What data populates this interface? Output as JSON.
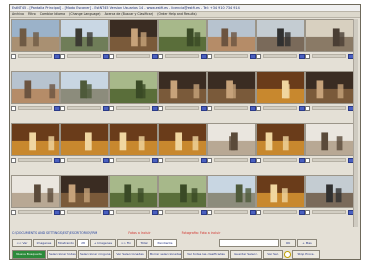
{
  "window": {
    "title": "EstNT45 - [Pantalla Principal] - [Modo Escaner] - EstNT45 Version Usuarios 14 - www.estfi.es - licencia@estfi.es - Tel: +34 910 734 914",
    "menu": [
      "Archivo",
      "Filtro",
      "Cambiar Idioma",
      "(Change Language)",
      "Acerca de (Buscar y Clasificar)",
      "(Order Help and Results)"
    ]
  },
  "thumbnails": [
    {
      "row": 0,
      "col": 0,
      "scene": "outdoor-street"
    },
    {
      "row": 0,
      "col": 1,
      "scene": "outdoor-people"
    },
    {
      "row": 0,
      "col": 2,
      "scene": "indoor-dark"
    },
    {
      "row": 0,
      "col": 3,
      "scene": "outdoor-garden"
    },
    {
      "row": 0,
      "col": 4,
      "scene": "outdoor-town"
    },
    {
      "row": 0,
      "col": 5,
      "scene": "outdoor-crowd"
    },
    {
      "row": 0,
      "col": 6,
      "scene": "outdoor-arch"
    },
    {
      "row": 1,
      "col": 0,
      "scene": "outdoor-town"
    },
    {
      "row": 1,
      "col": 1,
      "scene": "outdoor-road"
    },
    {
      "row": 1,
      "col": 2,
      "scene": "outdoor-garden"
    },
    {
      "row": 1,
      "col": 3,
      "scene": "indoor-dark"
    },
    {
      "row": 1,
      "col": 4,
      "scene": "indoor-dark"
    },
    {
      "row": 1,
      "col": 5,
      "scene": "indoor-warm"
    },
    {
      "row": 1,
      "col": 6,
      "scene": "indoor-dark"
    },
    {
      "row": 2,
      "col": 0,
      "scene": "indoor-warm"
    },
    {
      "row": 2,
      "col": 1,
      "scene": "indoor-warm"
    },
    {
      "row": 2,
      "col": 2,
      "scene": "indoor-warm"
    },
    {
      "row": 2,
      "col": 3,
      "scene": "indoor-warm"
    },
    {
      "row": 2,
      "col": 4,
      "scene": "indoor-light"
    },
    {
      "row": 2,
      "col": 5,
      "scene": "indoor-warm"
    },
    {
      "row": 2,
      "col": 6,
      "scene": "indoor-light"
    },
    {
      "row": 3,
      "col": 0,
      "scene": "indoor-light"
    },
    {
      "row": 3,
      "col": 1,
      "scene": "indoor-dark"
    },
    {
      "row": 3,
      "col": 2,
      "scene": "outdoor-garden"
    },
    {
      "row": 3,
      "col": 3,
      "scene": "outdoor-garden"
    },
    {
      "row": 3,
      "col": 4,
      "scene": "outdoor-road"
    },
    {
      "row": 3,
      "col": 5,
      "scene": "indoor-warm"
    },
    {
      "row": 3,
      "col": 6,
      "scene": "outdoor-crowd"
    }
  ],
  "status": {
    "path": "C:\\DOCUMENTS AND SETTINGS\\EST\\ESCRITORIO\\FRM",
    "count_label": "Fotos a Incluir",
    "warning": "Fotografia: Foto a incluir"
  },
  "toolbar1": {
    "back": "<< Ver",
    "images": "Imagenes",
    "shown_label": "Mostrando",
    "shown_value": "28",
    "more_images": "+ Imagenes",
    "fit": ">> Fin",
    "total_label": "Total",
    "total_value": "Pendiente",
    "ok": "OK",
    "more": "+ Mas"
  },
  "toolbar2": {
    "new_search": "Nueva Busqueda",
    "select_all": "Seleccionar todas",
    "select_none": "Seleccionar ninguna",
    "see_selected": "Ver Seleccionadas",
    "delete": "Borrar seleccionadas",
    "classify": "Ver todas las clasificadas",
    "save": "Guardar Selecc.",
    "see": "Ver Sel.",
    "stop": "Stop Proce."
  },
  "colors": {
    "accent": "#4a60c0",
    "green": "#2b8a3a",
    "warning": "#d0302a"
  }
}
